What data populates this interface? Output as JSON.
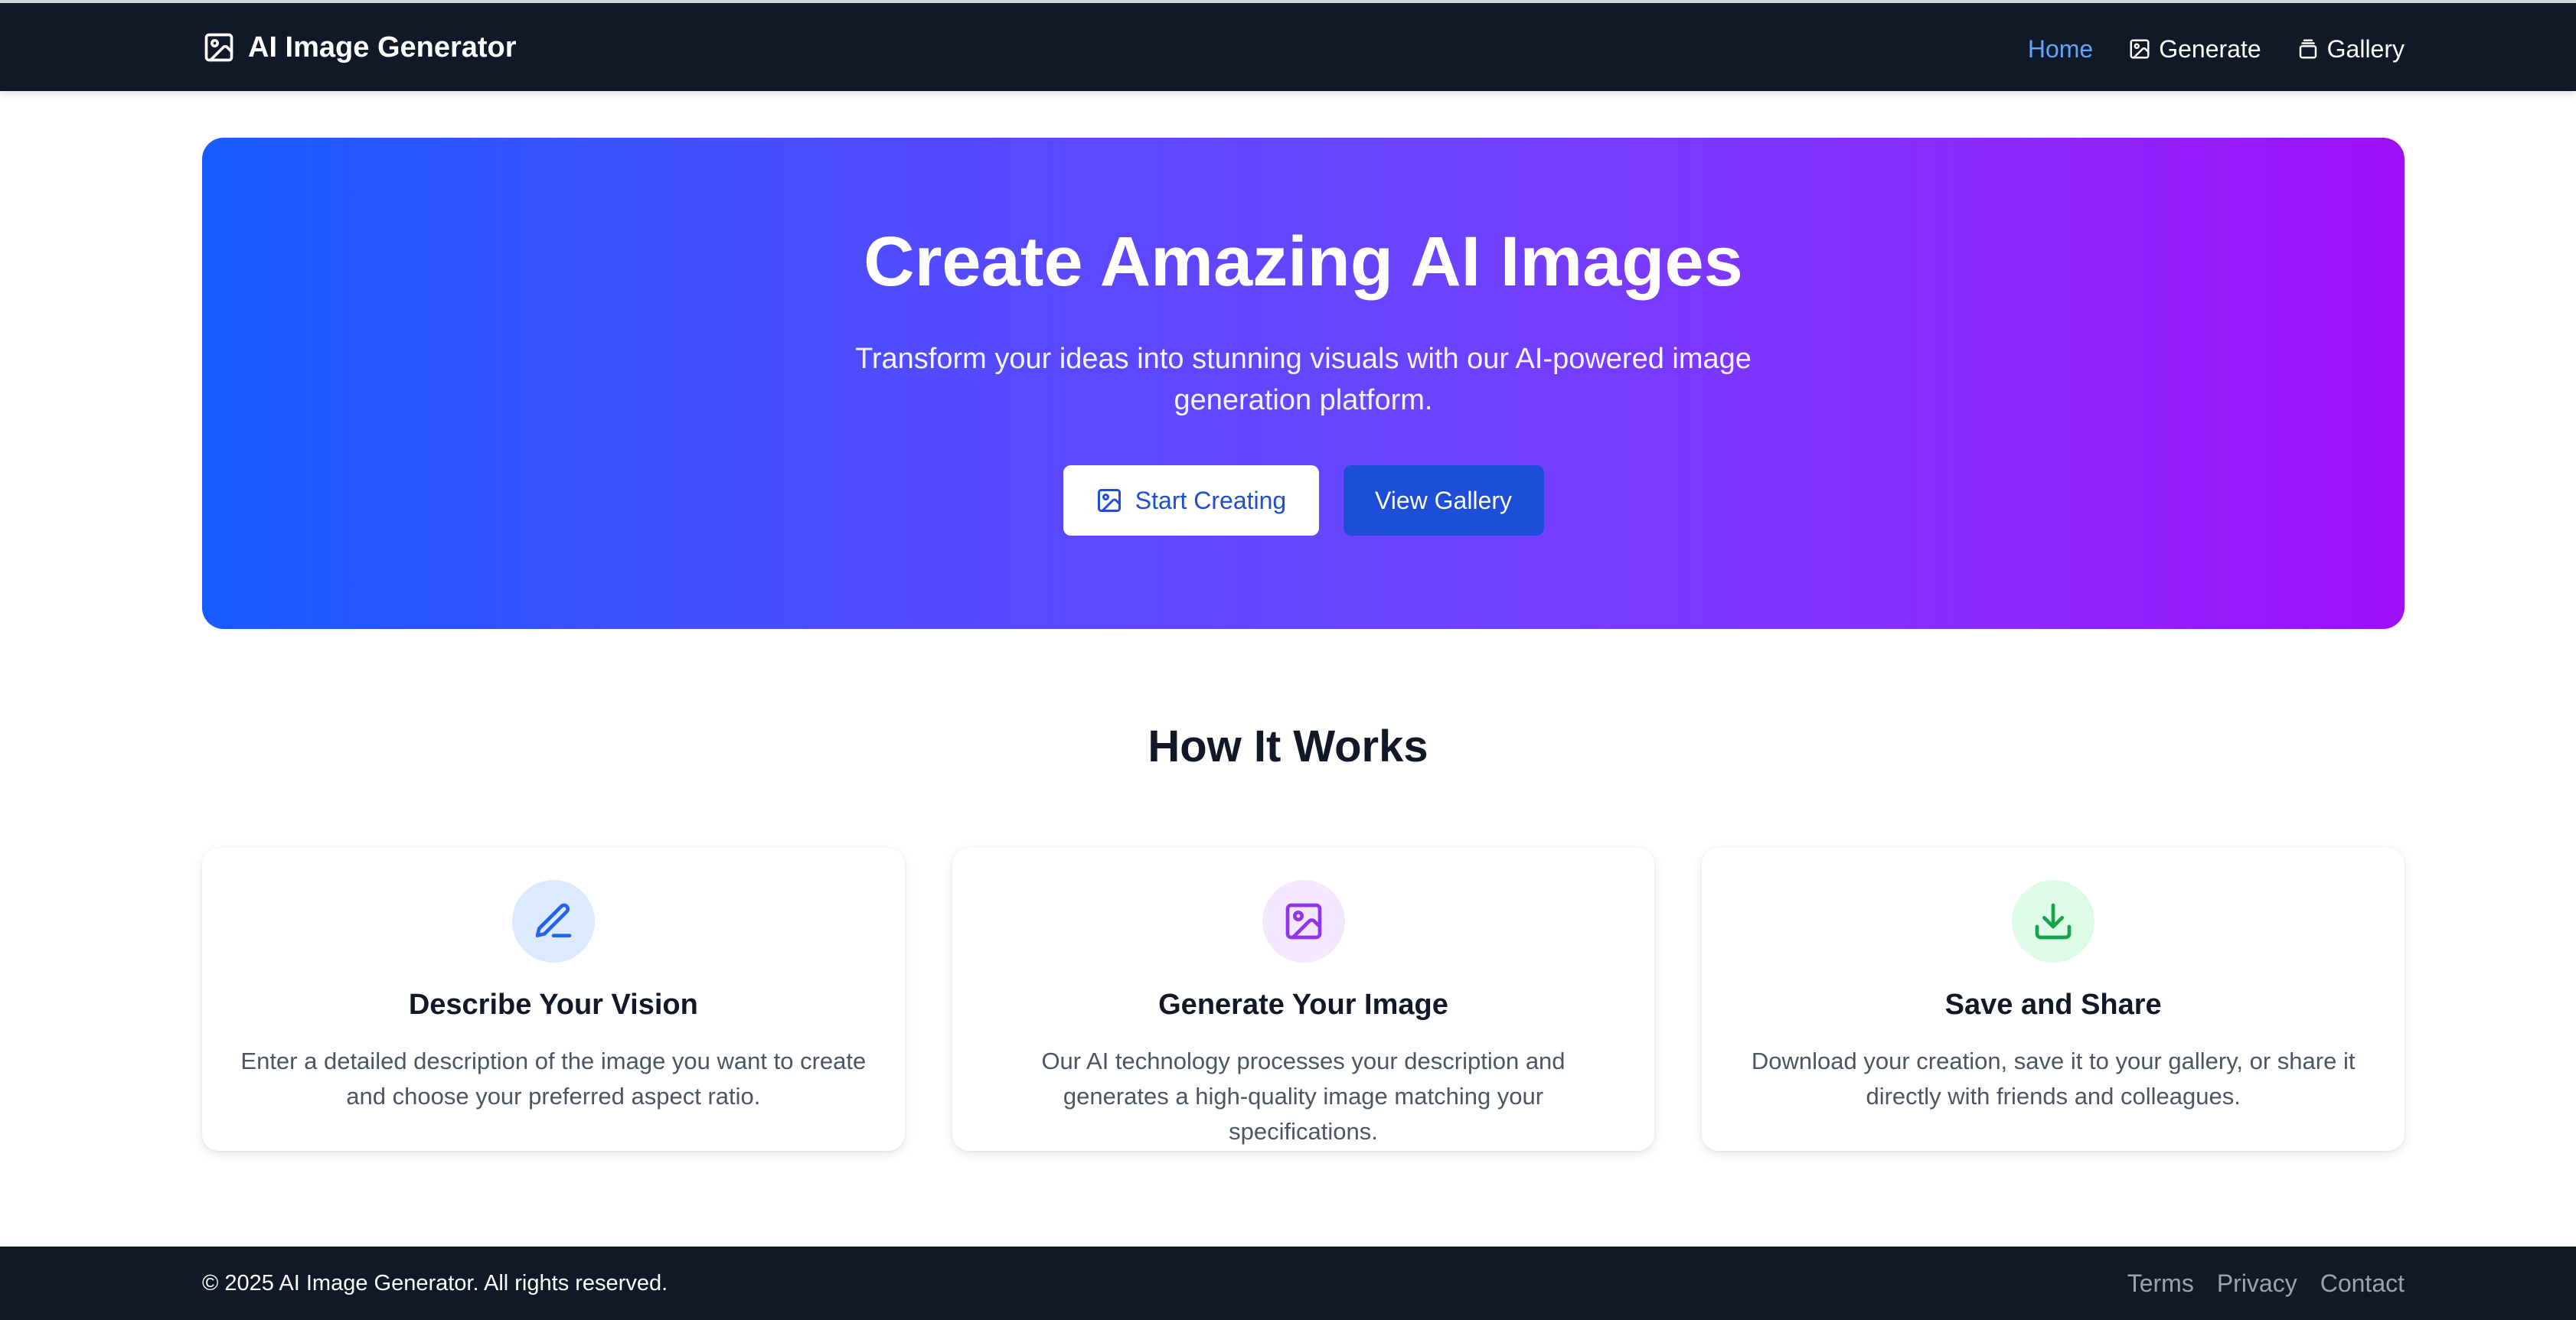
{
  "navbar": {
    "brand": "AI Image Generator",
    "brand_icon": "image-icon",
    "links": [
      {
        "label": "Home",
        "active": true
      },
      {
        "label": "Generate",
        "icon": "image-icon"
      },
      {
        "label": "Gallery",
        "icon": "stack-icon"
      }
    ]
  },
  "hero": {
    "title": "Create Amazing AI Images",
    "subtitle": "Transform your ideas into stunning visuals with our AI-powered image generation platform.",
    "primary_button": "Start Creating",
    "primary_button_icon": "image-icon",
    "secondary_button": "View Gallery",
    "gradient_start": "#185cff",
    "gradient_end": "#9f10f7"
  },
  "how_it_works": {
    "title": "How It Works",
    "cards": [
      {
        "icon": "pencil-icon",
        "icon_color": "#2563eb",
        "icon_bg": "#dbeafe",
        "title": "Describe Your Vision",
        "description": "Enter a detailed description of the image you want to create and choose your preferred aspect ratio."
      },
      {
        "icon": "image-icon",
        "icon_color": "#9333ea",
        "icon_bg": "#f3e8ff",
        "title": "Generate Your Image",
        "description": "Our AI technology processes your description and generates a high-quality image matching your specifications."
      },
      {
        "icon": "download-icon",
        "icon_color": "#16a34a",
        "icon_bg": "#dcfce7",
        "title": "Save and Share",
        "description": "Download your creation, save it to your gallery, or share it directly with friends and colleagues."
      }
    ]
  },
  "footer": {
    "copyright": "© 2025 AI Image Generator. All rights reserved.",
    "links": [
      "Terms",
      "Privacy",
      "Contact"
    ]
  }
}
